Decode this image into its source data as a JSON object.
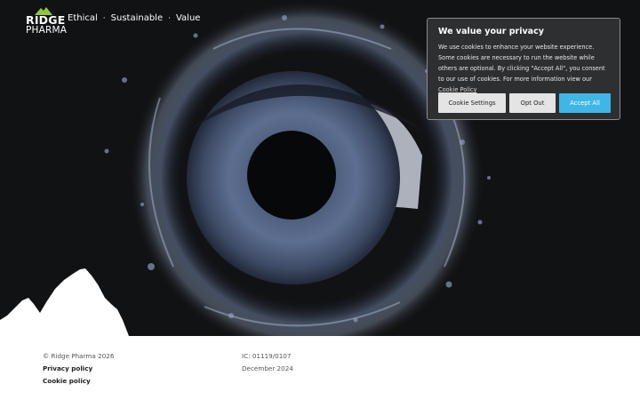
{
  "header": {
    "logo_line1": "RIDGE",
    "logo_line2": "PHARMA",
    "tagline": [
      "Ethical",
      "Sustainable",
      "Value"
    ],
    "tagline_separator": "·"
  },
  "colors": {
    "accent": "#3fb6e6",
    "logo_peak": "#8dc63f",
    "hero_background": "#111214"
  },
  "cookie_banner": {
    "title": "We value your privacy",
    "body": "We use cookies to enhance your website experience. Some cookies are necessary to run the website while others are optional. By clicking \"Accept All\", you consent to our use of cookies. For more information view our",
    "policy_link": "Cookie Policy",
    "buttons": {
      "settings": "Cookie Settings",
      "opt_out": "Opt Out",
      "accept": "Accept All"
    }
  },
  "footer": {
    "copyright": "© Ridge Pharma 2026",
    "privacy_link": "Privacy policy",
    "cookie_link": "Cookie policy",
    "ic_code": "IC: 01119/0107",
    "date": "December 2024"
  }
}
